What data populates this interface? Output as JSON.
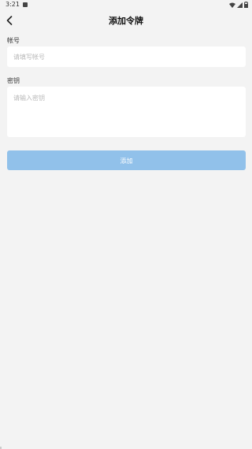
{
  "status_bar": {
    "time": "3:21",
    "icons": [
      "notification-icon",
      "wifi-icon",
      "signal-icon",
      "battery-icon"
    ]
  },
  "header": {
    "title": "添加令牌",
    "back_icon": "chevron-left-icon"
  },
  "form": {
    "account": {
      "label": "帐号",
      "placeholder": "请填写帐号",
      "value": ""
    },
    "secret": {
      "label": "密钥",
      "placeholder": "请输入密钥",
      "value": ""
    },
    "submit_label": "添加"
  },
  "colors": {
    "background": "#f3f3f3",
    "button": "#91c1ea",
    "input_bg": "#ffffff"
  }
}
